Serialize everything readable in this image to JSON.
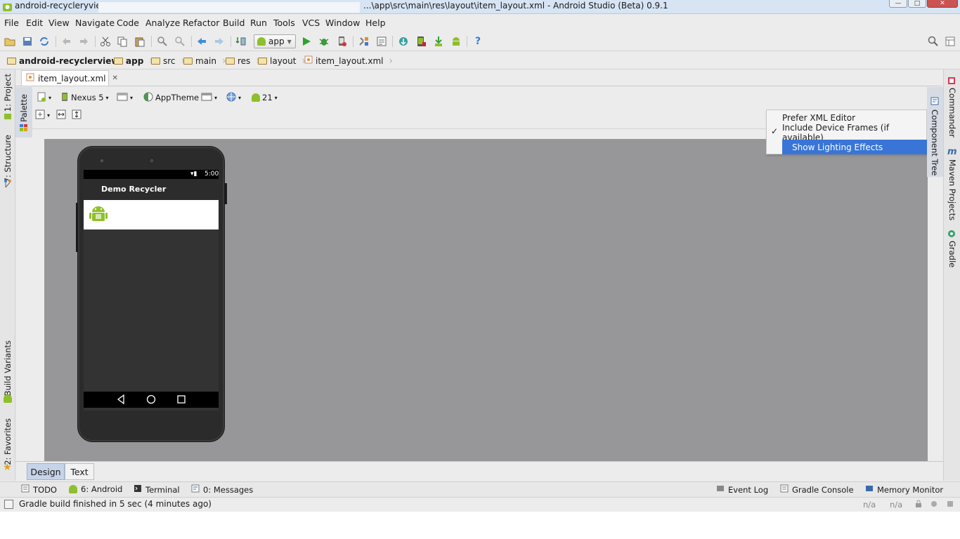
{
  "titlebar": {
    "app_name": "android-recycleryview -",
    "title_path": "...\\app\\src\\main\\res\\layout\\item_layout.xml - Android Studio (Beta) 0.9.1",
    "minimize": "—",
    "maximize": "□",
    "close": "✕"
  },
  "menubar": {
    "items": [
      "File",
      "Edit",
      "View",
      "Navigate",
      "Code",
      "Analyze",
      "Refactor",
      "Build",
      "Run",
      "Tools",
      "VCS",
      "Window",
      "Help"
    ]
  },
  "toolbar": {
    "run_config": "app",
    "help": "?"
  },
  "breadcrumb": [
    "android-recyclerview",
    "app",
    "src",
    "main",
    "res",
    "layout",
    "item_layout.xml"
  ],
  "editor": {
    "tab_label": "item_layout.xml",
    "tab_close": "✕"
  },
  "left_tools": {
    "project": "1: Project",
    "structure": "7: Structure",
    "palette": "Palette",
    "build_variants": "Build Variants",
    "favorites": "2: Favorites"
  },
  "right_tools": {
    "commander": "Commander",
    "maven": "Maven Projects",
    "gradle": "Gradle",
    "component_tree": "Component Tree"
  },
  "design_toolbar": {
    "device": "Nexus 5",
    "theme": "AppTheme",
    "api_level": "21"
  },
  "phone": {
    "clock": "5:00",
    "action_bar_title": "Demo Recycler"
  },
  "popup_menu": {
    "items": [
      {
        "label": "Prefer XML Editor",
        "checked": false
      },
      {
        "label": "Include Device Frames (if available)",
        "checked": true
      },
      {
        "label": "Show Lighting Effects",
        "checked": false,
        "highlighted": true
      }
    ],
    "check_mark": "✓"
  },
  "design_tabs": {
    "design": "Design",
    "text": "Text"
  },
  "tool_windows": {
    "todo": "TODO",
    "android": "6: Android",
    "terminal": "Terminal",
    "messages": "0: Messages",
    "event_log": "Event Log",
    "gradle_console": "Gradle Console",
    "memory_monitor": "Memory Monitor"
  },
  "status": {
    "message": "Gradle build finished in 5 sec (4 minutes ago)",
    "na1": "n/a",
    "na2": "n/a"
  },
  "colors": {
    "selection": "#3875d7",
    "canvas": "#979799",
    "android_green": "#8fbf2c",
    "run_green": "#2aa52a"
  }
}
